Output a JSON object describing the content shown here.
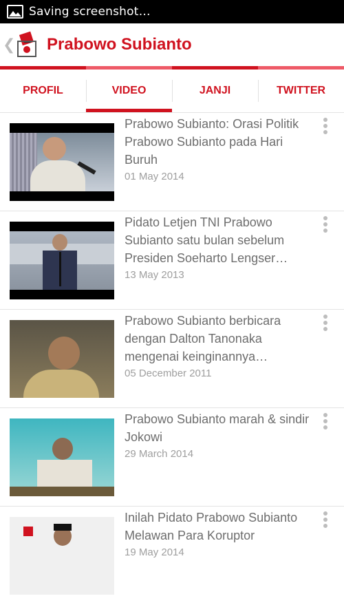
{
  "status_bar": {
    "text": "Saving screenshot…",
    "icon": "image-icon"
  },
  "header": {
    "back_glyph": "❮",
    "title": "Prabowo Subianto",
    "logo": "ballot-box-logo",
    "accent_color": "#d0121f"
  },
  "tabs": [
    {
      "label": "PROFIL",
      "active": false
    },
    {
      "label": "VIDEO",
      "active": true
    },
    {
      "label": "JANJI",
      "active": false
    },
    {
      "label": "TWITTER",
      "active": false
    }
  ],
  "videos": [
    {
      "title": "Prabowo Subianto: Orasi Politik Prabowo Subianto pada Hari Buruh",
      "date": "01 May 2014"
    },
    {
      "title": "Pidato Letjen TNI Prabowo Subianto satu bulan sebelum Presiden Soeharto Lengser…",
      "date": "13 May 2013"
    },
    {
      "title": "Prabowo Subianto berbicara dengan Dalton Tanonaka mengenai keinginannya…",
      "date": "05 December 2011"
    },
    {
      "title": "Prabowo Subianto marah & sindir Jokowi",
      "date": "29 March 2014"
    },
    {
      "title": "Inilah Pidato Prabowo Subianto Melawan Para Koruptor",
      "date": "19 May 2014"
    }
  ]
}
